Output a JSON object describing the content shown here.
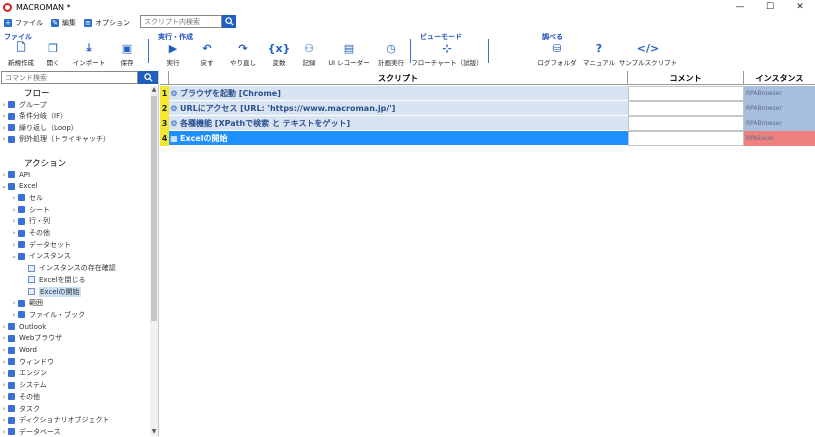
{
  "window": {
    "title": "MACROMAN *",
    "controls": [
      "—",
      "☐",
      "✕"
    ]
  },
  "menu": {
    "items": [
      {
        "label": "ファイル",
        "icon": "plus-icon"
      },
      {
        "label": "編集",
        "icon": "edit-icon"
      },
      {
        "label": "オプション",
        "icon": "options-icon"
      }
    ],
    "search_placeholder": "スクリプト内検索"
  },
  "toolbar": {
    "groups": {
      "file": "ファイル",
      "run": "実行・作成",
      "view": "ビューモード",
      "lookup": "調べる"
    },
    "tools": [
      {
        "label": "新規作成",
        "icon": "new-file-icon"
      },
      {
        "label": "開く",
        "icon": "open-icon"
      },
      {
        "label": "インポート",
        "icon": "import-icon"
      },
      {
        "label": "保存",
        "icon": "save-icon"
      },
      {
        "label": "実行",
        "icon": "play-icon"
      },
      {
        "label": "戻す",
        "icon": "undo-icon"
      },
      {
        "label": "やり直し",
        "icon": "redo-icon"
      },
      {
        "label": "変数",
        "icon": "variable-icon"
      },
      {
        "label": "記録",
        "icon": "record-icon"
      },
      {
        "label": "UI レコーダー",
        "icon": "ui-recorder-icon"
      },
      {
        "label": "計画実行",
        "icon": "schedule-icon"
      },
      {
        "label": "フローチャート（試版）",
        "icon": "flowchart-icon"
      },
      {
        "label": "ログフォルダ",
        "icon": "log-folder-icon"
      },
      {
        "label": "マニュアル",
        "icon": "manual-icon"
      },
      {
        "label": "サンプルスクリプト",
        "icon": "sample-script-icon"
      }
    ]
  },
  "left_panel": {
    "command_search_placeholder": "コマンド検索",
    "flow_title": "フロー",
    "flow_items": [
      "グループ",
      "条件分岐（IF）",
      "繰り返し（Loop）",
      "例外処理（トライキャッチ）"
    ],
    "action_title": "アクション",
    "action_items": [
      {
        "label": "API",
        "level": 0,
        "expanded": false
      },
      {
        "label": "Excel",
        "level": 0,
        "expanded": true
      },
      {
        "label": "セル",
        "level": 1,
        "expanded": false
      },
      {
        "label": "シート",
        "level": 1,
        "expanded": false
      },
      {
        "label": "行・列",
        "level": 1,
        "expanded": false
      },
      {
        "label": "その他",
        "level": 1,
        "expanded": false
      },
      {
        "label": "データセット",
        "level": 1,
        "expanded": false
      },
      {
        "label": "インスタンス",
        "level": 1,
        "expanded": true
      },
      {
        "label": "インスタンスの存在確認",
        "level": 2,
        "leaf": true
      },
      {
        "label": "Excelを閉じる",
        "level": 2,
        "leaf": true
      },
      {
        "label": "Excelの開始",
        "level": 2,
        "leaf": true,
        "selected": true
      },
      {
        "label": "範囲",
        "level": 1,
        "expanded": false
      },
      {
        "label": "ファイル・ブック",
        "level": 1,
        "expanded": false
      },
      {
        "label": "Outlook",
        "level": 0,
        "expanded": false
      },
      {
        "label": "Webブラウザ",
        "level": 0,
        "expanded": false
      },
      {
        "label": "Word",
        "level": 0,
        "expanded": false
      },
      {
        "label": "ウィンドウ",
        "level": 0,
        "expanded": false
      },
      {
        "label": "エンジン",
        "level": 0,
        "expanded": false
      },
      {
        "label": "システム",
        "level": 0,
        "expanded": false
      },
      {
        "label": "その他",
        "level": 0,
        "expanded": false
      },
      {
        "label": "タスク",
        "level": 0,
        "expanded": false
      },
      {
        "label": "ディクショナリオブジェクト",
        "level": 0,
        "expanded": false
      },
      {
        "label": "データベース",
        "level": 0,
        "expanded": false
      }
    ]
  },
  "grid": {
    "headers": {
      "script": "スクリプト",
      "comment": "コメント",
      "instance": "インスタンス"
    },
    "rows": [
      {
        "num": "1",
        "script": "ブラウザを起動 [Chrome]",
        "comment": "",
        "instance": "RPABrowser",
        "icon": "run-icon"
      },
      {
        "num": "2",
        "script": "URLにアクセス [URL: 'https://www.macroman.jp/']",
        "comment": "",
        "instance": "RPABrowser",
        "icon": "run-icon"
      },
      {
        "num": "3",
        "script": "各種機能 [XPathで検索 と テキストをゲット]",
        "comment": "",
        "instance": "RPABrowser",
        "icon": "run-icon"
      },
      {
        "num": "4",
        "script": "Excelの開始",
        "comment": "",
        "instance": "RPAExcel",
        "icon": "excel-icon",
        "selected": true
      }
    ]
  },
  "colors": {
    "accent": "#1f5fbf",
    "selected_row": "#1e90ff",
    "row_bg": "#d9e4f2",
    "instance_bg": "#a7bfdd",
    "instance_selected_bg": "#ee8080",
    "row_number_bg": "#f5e830",
    "error_line": "#d32020"
  }
}
